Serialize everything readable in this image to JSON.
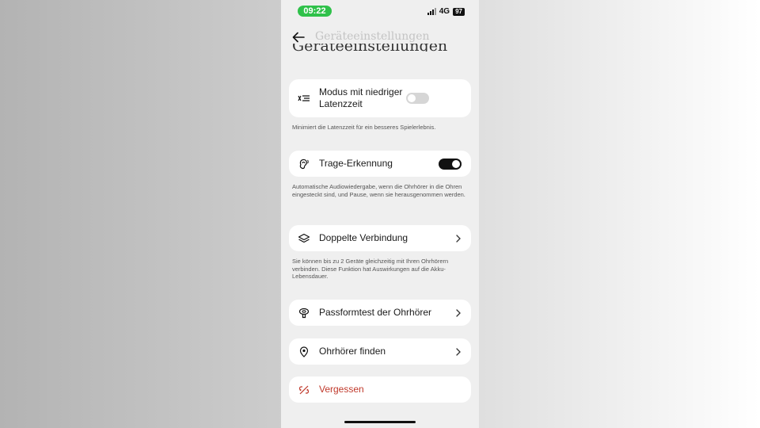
{
  "status": {
    "time": "09:22",
    "network": "4G",
    "battery": "97",
    "time_badge_color": "#2fc14a"
  },
  "header": {
    "title": "Geräteeinstellungen",
    "large_title": "Geräteeinstellungen"
  },
  "settings": {
    "low_latency": {
      "label": "Modus mit niedriger Latenzzeit",
      "description": "Minimiert die Latenzzeit für ein besseres Spielerlebnis.",
      "enabled": false,
      "icon": "latency-icon"
    },
    "wear_detection": {
      "label": "Trage-Erkennung",
      "description": "Automatische Audiowiedergabe, wenn die Ohrhörer in die Ohren eingesteckt sind, und Pause, wenn sie herausgenommen werden.",
      "enabled": true,
      "icon": "ear-icon"
    },
    "dual_connection": {
      "label": "Doppelte Verbindung",
      "description": "Sie können bis zu 2 Geräte gleichzeitig mit Ihren Ohrhörern verbinden. Diese Funktion hat Auswirkungen auf die Akku-Lebensdauer.",
      "icon": "layers-icon"
    },
    "fit_test": {
      "label": "Passformtest der Ohrhörer",
      "icon": "earbud-icon"
    },
    "find_earbuds": {
      "label": "Ohrhörer finden",
      "icon": "location-pin-icon"
    },
    "forget": {
      "label": "Vergessen",
      "icon": "unlink-icon",
      "color": "#c0392b"
    }
  }
}
